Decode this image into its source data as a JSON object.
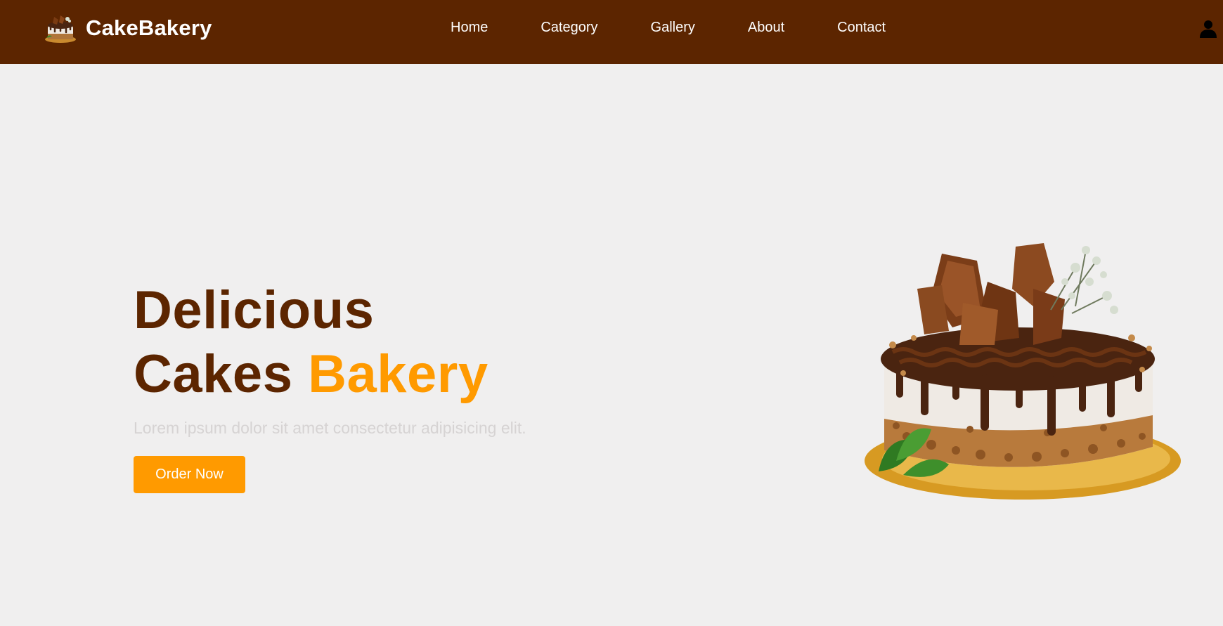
{
  "navbar": {
    "brand_name": "CakeBakery",
    "links": [
      {
        "label": "Home"
      },
      {
        "label": "Category"
      },
      {
        "label": "Gallery"
      },
      {
        "label": "About"
      },
      {
        "label": "Contact"
      }
    ],
    "user_icon": "user-icon"
  },
  "hero": {
    "title_line1": "Delicious",
    "title_line2_main": "Cakes ",
    "title_line2_accent": "Bakery",
    "subtitle": "Lorem ipsum dolor sit amet consectetur adipisicing elit.",
    "cta_label": "Order Now",
    "image_icon": "chocolate-cake-image"
  },
  "colors": {
    "navbar_bg": "#5c2500",
    "accent": "#ff9a00",
    "title": "#5c2500",
    "page_bg": "#f0efef",
    "subtitle": "#d6d3d3"
  }
}
